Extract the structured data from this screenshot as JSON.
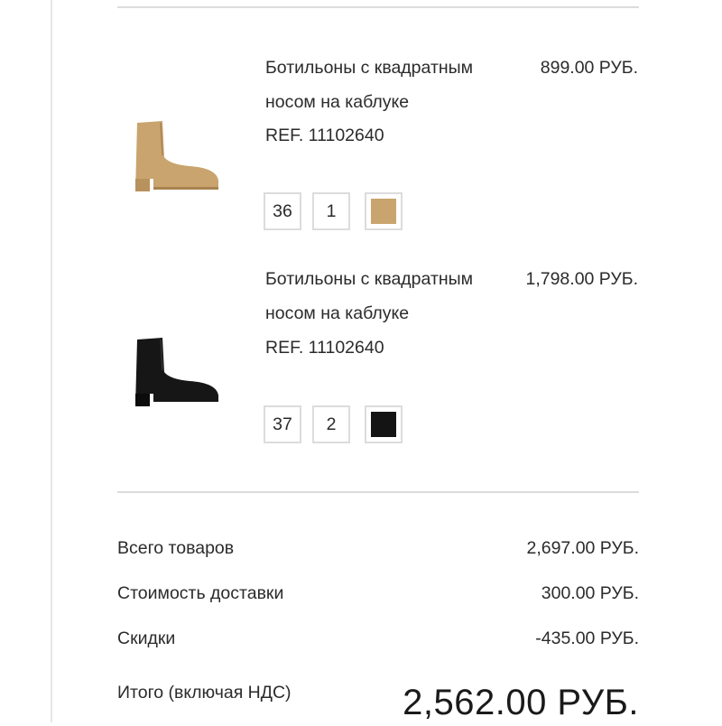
{
  "cart": {
    "items": [
      {
        "name_line1": "Ботильоны с квадратным",
        "name_line2": "носом на каблуке",
        "ref": "REF. 11102640",
        "price": "899.00 РУБ.",
        "size": "36",
        "quantity": "1",
        "color": "#c9a46e",
        "image_icon": "ankle-boot-beige-icon"
      },
      {
        "name_line1": "Ботильоны с квадратным",
        "name_line2": "носом на каблуке",
        "ref": "REF. 11102640",
        "price": "1,798.00 РУБ.",
        "size": "37",
        "quantity": "2",
        "color": "#141414",
        "image_icon": "ankle-boot-black-icon"
      }
    ]
  },
  "summary": {
    "subtotal_label": "Всего товаров",
    "subtotal_value": "2,697.00 РУБ.",
    "shipping_label": "Стоимость доставки",
    "shipping_value": "300.00 РУБ.",
    "discount_label": "Скидки",
    "discount_value": "-435.00 РУБ.",
    "total_label": "Итого (включая НДС)",
    "total_value": "2,562.00 РУБ."
  },
  "colors": {
    "divider": "#dcdcdc",
    "text": "#2b2b2b"
  }
}
